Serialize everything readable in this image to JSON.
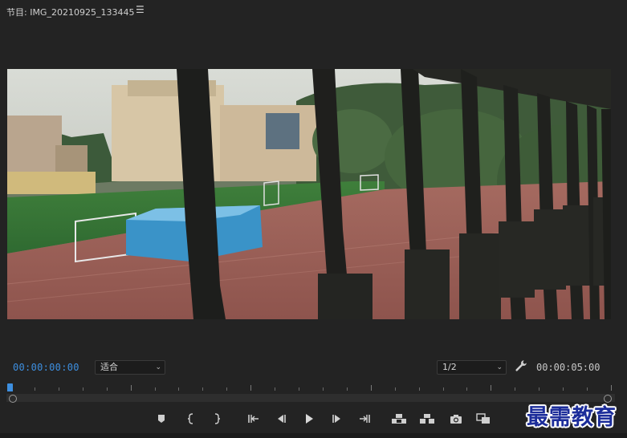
{
  "panel": {
    "title": "节目: IMG_20210925_133445",
    "menu_icon": "hamburger-menu-icon"
  },
  "viewer": {
    "content": "program-monitor-video-frame"
  },
  "playback": {
    "current_timecode": "00:00:00:00",
    "duration_timecode": "00:00:05:00",
    "zoom_level": "适合",
    "resolution": "1/2",
    "playhead_position": 0
  },
  "controls": [
    {
      "name": "add-marker-icon"
    },
    {
      "name": "mark-in-icon"
    },
    {
      "name": "mark-out-icon"
    },
    {
      "name": "go-to-in-icon"
    },
    {
      "name": "step-back-icon"
    },
    {
      "name": "play-icon"
    },
    {
      "name": "step-forward-icon"
    },
    {
      "name": "go-to-out-icon"
    },
    {
      "name": "lift-icon"
    },
    {
      "name": "extract-icon"
    },
    {
      "name": "export-frame-icon"
    },
    {
      "name": "comparison-view-icon"
    }
  ],
  "watermark": {
    "text": "最需教育"
  },
  "colors": {
    "accent": "#3d8fe0",
    "background": "#232323"
  }
}
